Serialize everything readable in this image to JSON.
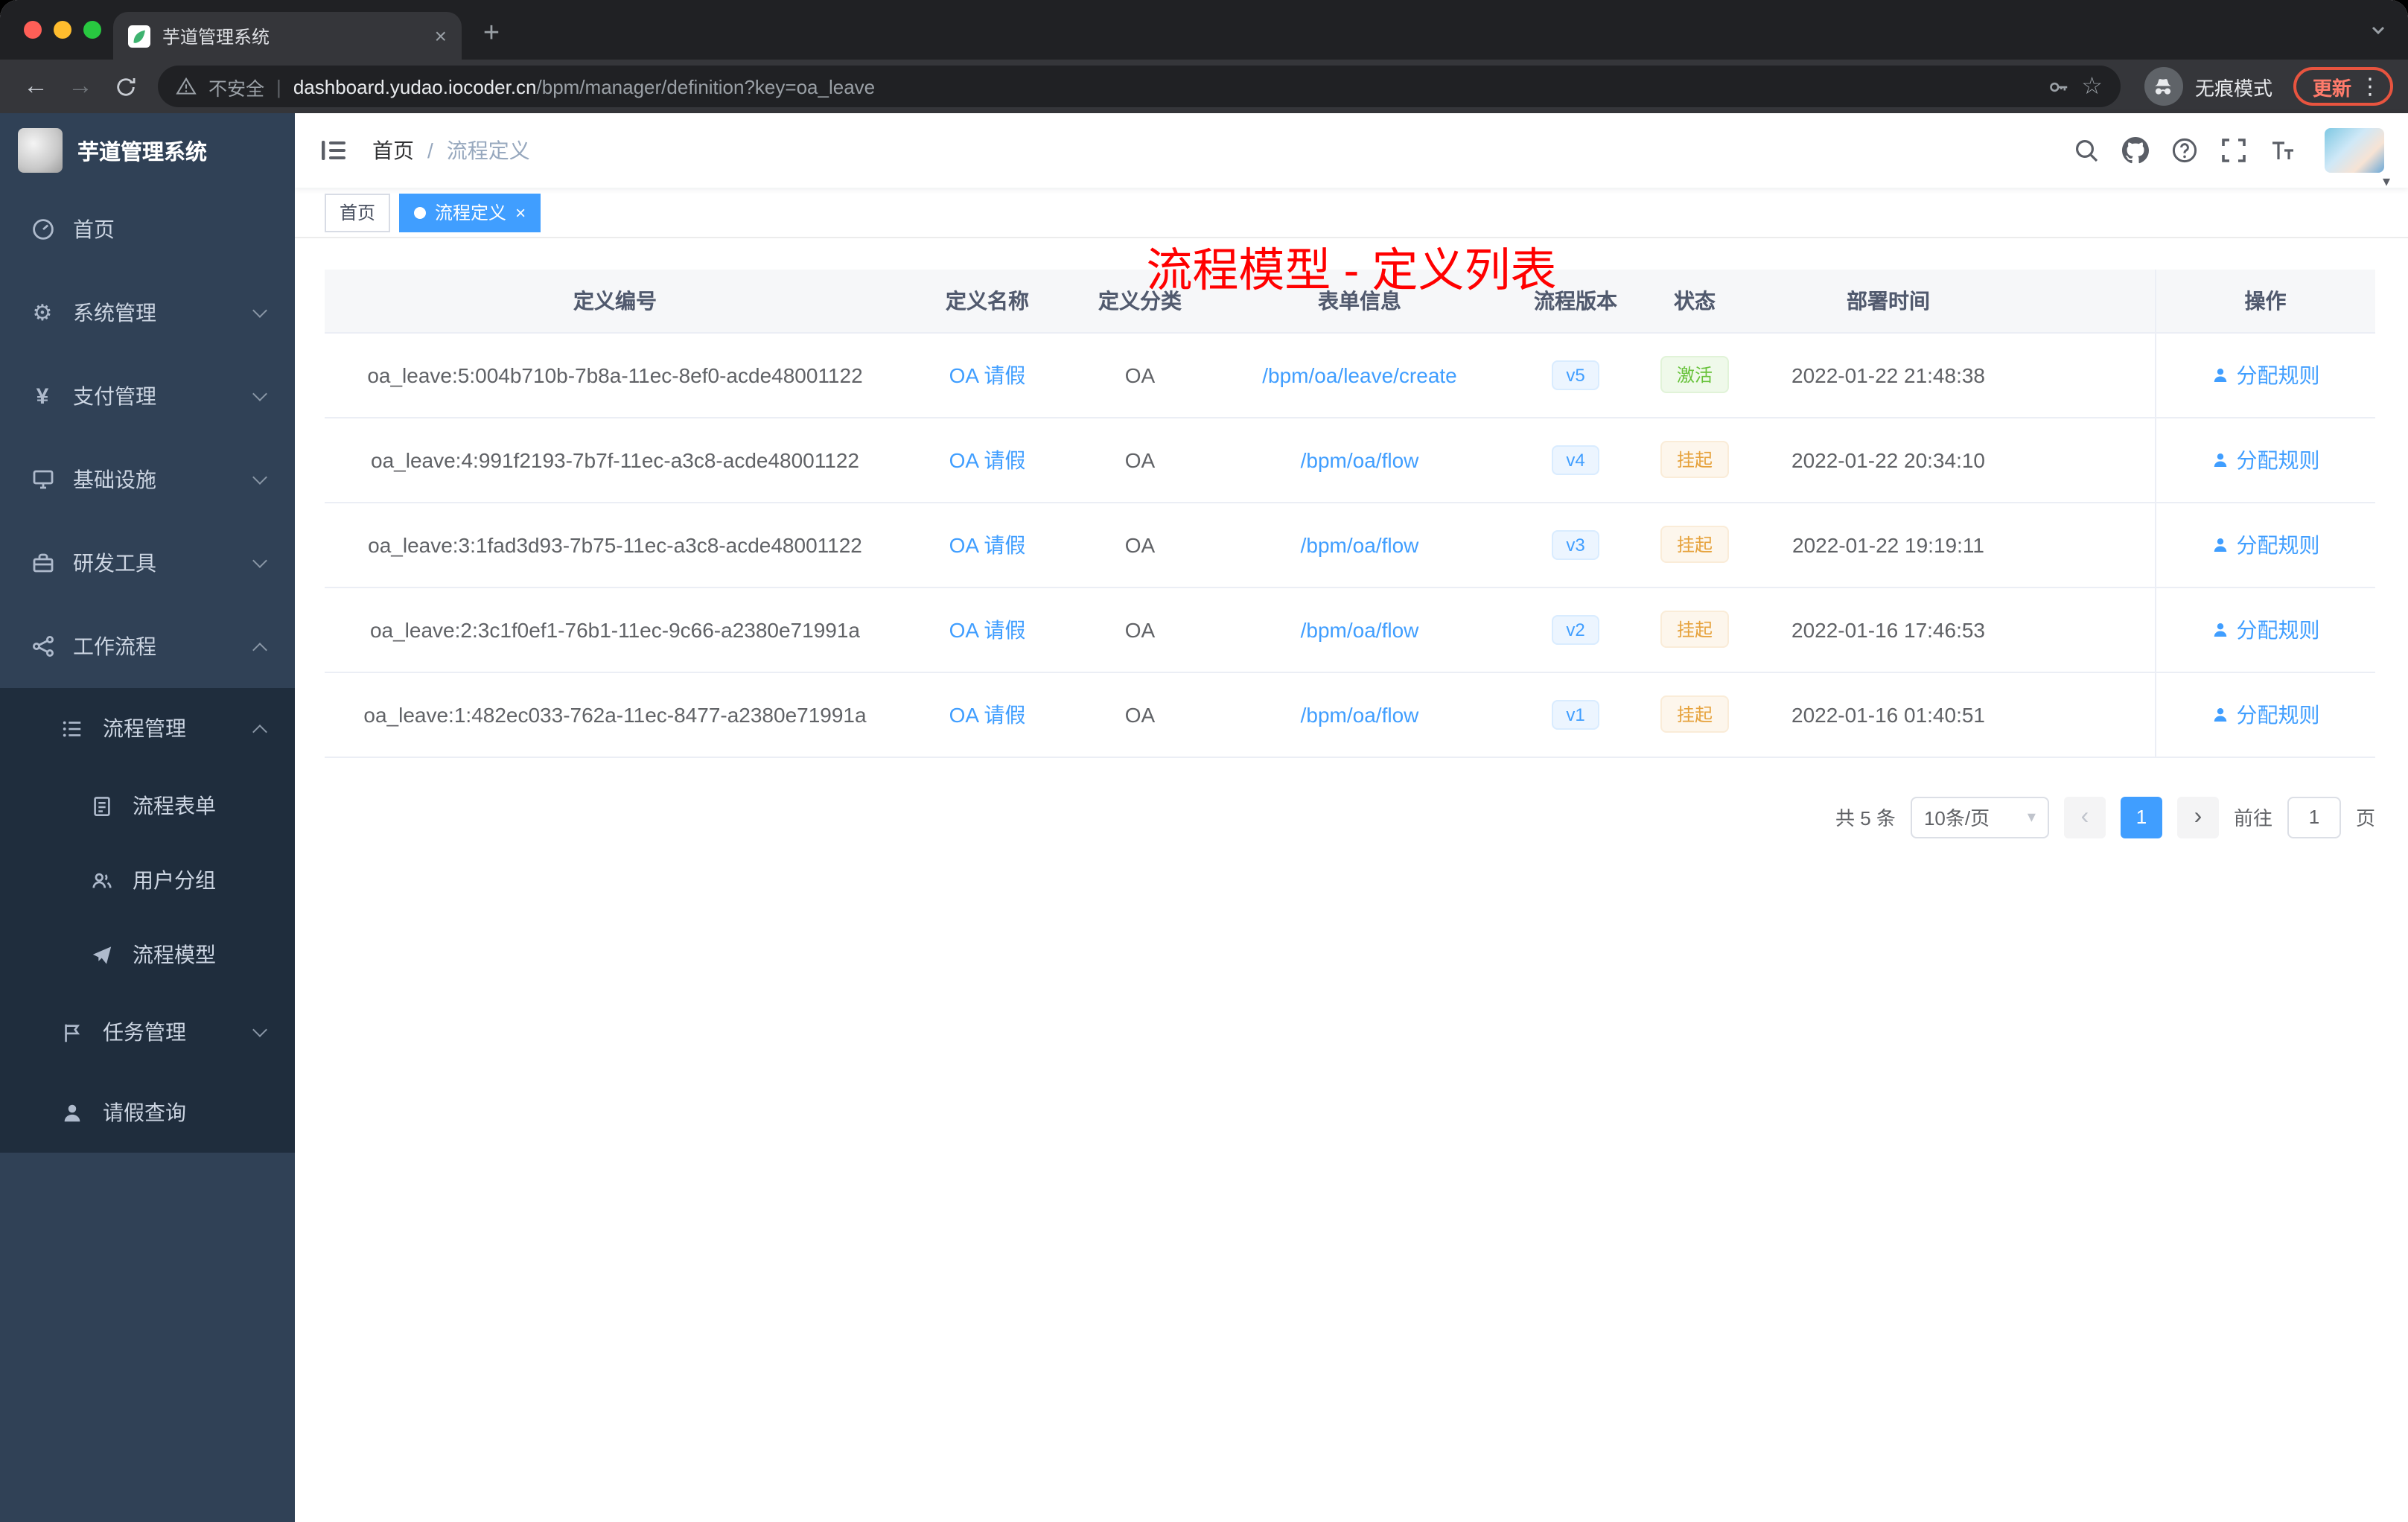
{
  "browser": {
    "tab_title": "芋道管理系统",
    "security_label": "不安全",
    "url_host": "dashboard.yudao.iocoder.cn",
    "url_path": "/bpm/manager/definition?key=oa_leave",
    "incognito_label": "无痕模式",
    "update_label": "更新"
  },
  "icons": {
    "back": "←",
    "forward": "→",
    "star": "☆",
    "kebab": "⋮",
    "close": "×",
    "new_tab": "+",
    "caret": "▾",
    "gear": "⚙",
    "yen": "¥",
    "url_divider": "|",
    "prev": "‹",
    "next": "›",
    "tag_close": "×"
  },
  "sidebar": {
    "logo_title": "芋道管理系统",
    "items": [
      "首页",
      "系统管理",
      "支付管理",
      "基础设施",
      "研发工具",
      "工作流程",
      "流程管理",
      "流程表单",
      "用户分组",
      "流程模型",
      "任务管理",
      "请假查询"
    ]
  },
  "header": {
    "breadcrumb": [
      "首页",
      "流程定义"
    ],
    "separator": "/",
    "annotation": "流程模型 - 定义列表"
  },
  "tags": {
    "items": [
      "首页",
      "流程定义"
    ]
  },
  "table": {
    "columns": [
      "定义编号",
      "定义名称",
      "定义分类",
      "表单信息",
      "流程版本",
      "状态",
      "部署时间",
      "操作"
    ],
    "rows": [
      {
        "id": "oa_leave:5:004b710b-7b8a-11ec-8ef0-acde48001122",
        "name": "OA 请假",
        "category": "OA",
        "form": "/bpm/oa/leave/create",
        "version": "v5",
        "status": "激活",
        "status_type": "success",
        "time": "2022-01-22 21:48:38",
        "action": "分配规则"
      },
      {
        "id": "oa_leave:4:991f2193-7b7f-11ec-a3c8-acde48001122",
        "name": "OA 请假",
        "category": "OA",
        "form": "/bpm/oa/flow",
        "version": "v4",
        "status": "挂起",
        "status_type": "warning",
        "time": "2022-01-22 20:34:10",
        "action": "分配规则"
      },
      {
        "id": "oa_leave:3:1fad3d93-7b75-11ec-a3c8-acde48001122",
        "name": "OA 请假",
        "category": "OA",
        "form": "/bpm/oa/flow",
        "version": "v3",
        "status": "挂起",
        "status_type": "warning",
        "time": "2022-01-22 19:19:11",
        "action": "分配规则"
      },
      {
        "id": "oa_leave:2:3c1f0ef1-76b1-11ec-9c66-a2380e71991a",
        "name": "OA 请假",
        "category": "OA",
        "form": "/bpm/oa/flow",
        "version": "v2",
        "status": "挂起",
        "status_type": "warning",
        "time": "2022-01-16 17:46:53",
        "action": "分配规则"
      },
      {
        "id": "oa_leave:1:482ec033-762a-11ec-8477-a2380e71991a",
        "name": "OA 请假",
        "category": "OA",
        "form": "/bpm/oa/flow",
        "version": "v1",
        "status": "挂起",
        "status_type": "warning",
        "time": "2022-01-16 01:40:51",
        "action": "分配规则"
      }
    ]
  },
  "pagination": {
    "total": "共 5 条",
    "page_size": "10条/页",
    "current_page": "1",
    "goto_label": "前往",
    "goto_value": "1",
    "page_unit": "页"
  },
  "colors": {
    "accent": "#409EFF",
    "annotation_red": "#FF0000",
    "status_active_green": "#67C23A",
    "status_suspend_orange": "#E6A23C",
    "sidebar_bg": "#304156",
    "sidebar_submenu_bg": "#1F2D3D"
  }
}
